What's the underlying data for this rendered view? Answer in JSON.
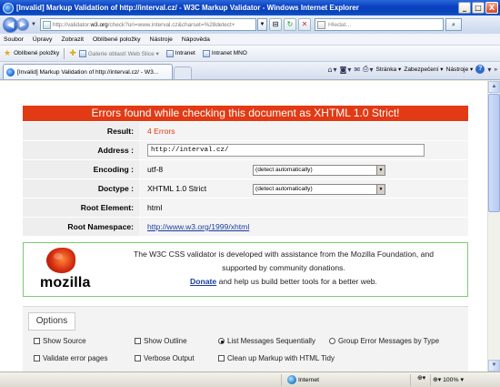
{
  "window": {
    "title": "[Invalid] Markup Validation of http://interval.cz/ - W3C Markup Validator - Windows Internet Explorer",
    "min_glyph": "_",
    "max_glyph": "□",
    "close_glyph": "X"
  },
  "address_bar": {
    "url_prefix": "http://validator.",
    "url_host": "w3.org",
    "url_rest": "/check?uri=www.interval.cz&charset=%28detect+",
    "search_placeholder": "Hledat..."
  },
  "menu": [
    "Soubor",
    "Úpravy",
    "Zobrazit",
    "Oblíbené položky",
    "Nástroje",
    "Nápověda"
  ],
  "favorites_bar": {
    "label": "Oblíbené položky",
    "items": [
      {
        "label": "Galerie oblastí Web Slice ▾",
        "dim": true
      },
      {
        "label": "Intranet",
        "dim": false
      },
      {
        "label": "Intranet MNO",
        "dim": false
      }
    ]
  },
  "tab": {
    "label": "[Invalid] Markup Validation of http://interval.cz/ - W3..."
  },
  "command_bar": {
    "page": "Stránka ▾",
    "security": "Zabezpečení ▾",
    "tools": "Nástroje ▾",
    "help_glyph": "?",
    "more": "»"
  },
  "validator": {
    "heading": "Errors found while checking this document as XHTML 1.0 Strict!",
    "rows": {
      "result_label": "Result:",
      "result_value": "4 Errors",
      "address_label": "Address :",
      "address_value": "http://interval.cz/",
      "encoding_label": "Encoding :",
      "encoding_value": "utf-8",
      "encoding_select": "(detect automatically)",
      "doctype_label": "Doctype :",
      "doctype_value": "XHTML 1.0 Strict",
      "doctype_select": "(detect automatically)",
      "root_element_label": "Root Element:",
      "root_element_value": "html",
      "root_namespace_label": "Root Namespace:",
      "root_namespace_value": "http://www.w3.org/1999/xhtml"
    }
  },
  "mozilla": {
    "logo_word": "mozilla",
    "line1": "The W3C CSS validator is developed with assistance from the Mozilla Foundation, and",
    "line2": "supported by community donations.",
    "donate": "Donate",
    "line3": " and help us build better tools for a better web."
  },
  "options": {
    "heading": "Options",
    "show_source": "Show Source",
    "show_outline": "Show Outline",
    "list_sequential": "List Messages Sequentially",
    "group_errors": "Group Error Messages by Type",
    "validate_error_pages": "Validate error pages",
    "verbose_output": "Verbose Output",
    "cleanup_tidy": "Clean up Markup with HTML Tidy",
    "list_sequential_selected": true
  },
  "status_bar": {
    "zone": "Internet",
    "zoom": "100%"
  },
  "colors": {
    "error_red": "#e23a14",
    "link_blue": "#1a3ca0",
    "mozilla_border": "#7acb72"
  }
}
